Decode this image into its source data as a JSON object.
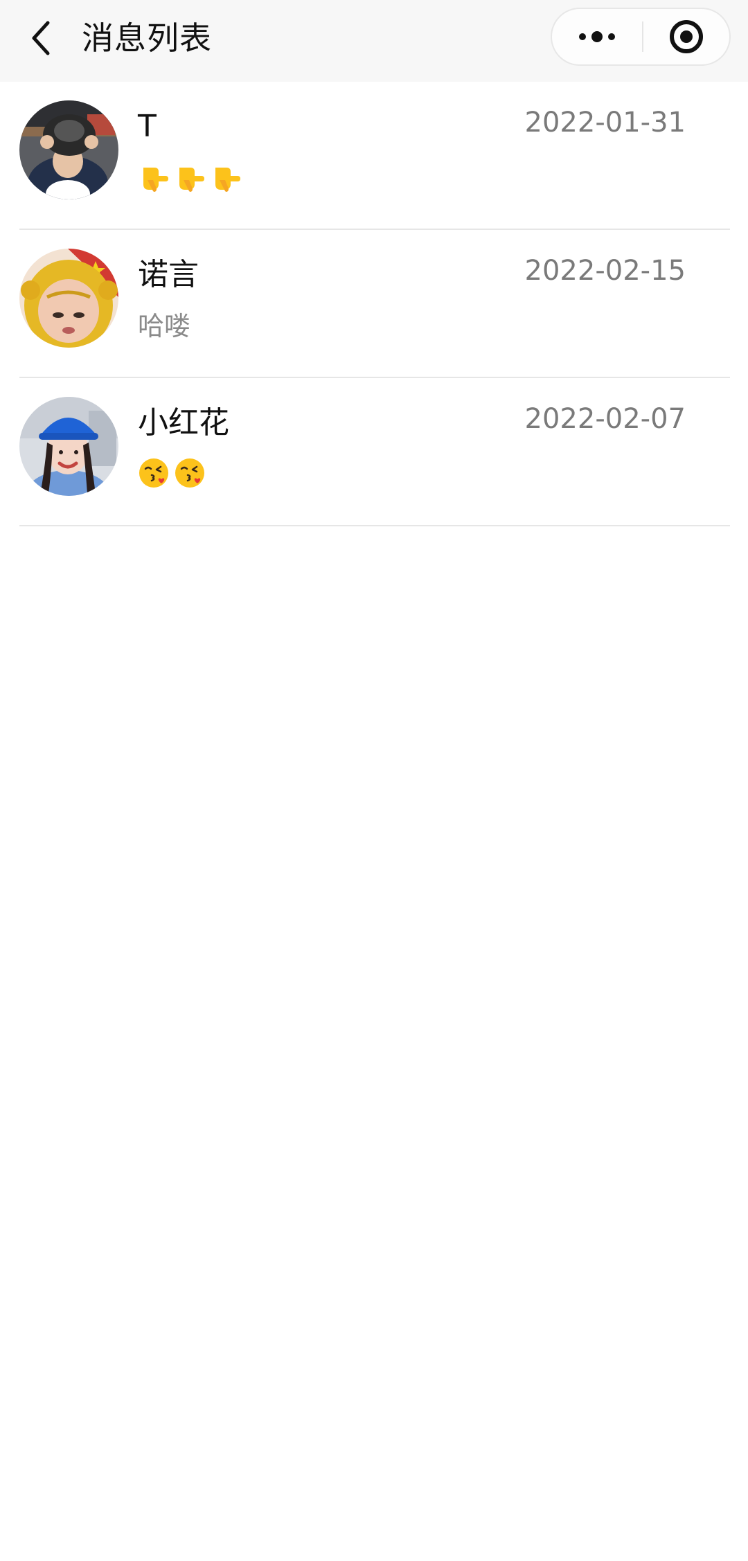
{
  "navbar": {
    "title": "消息列表"
  },
  "icons": {
    "back": "chevron-left-icon",
    "more": "more-dots-icon",
    "close": "target-close-icon"
  },
  "messages": [
    {
      "name": "T",
      "date": "2022-01-31",
      "preview_text": "",
      "preview_emojis": [
        "pointing-hand-emoji",
        "pointing-hand-emoji",
        "pointing-hand-emoji"
      ]
    },
    {
      "name": "诺言",
      "date": "2022-02-15",
      "preview_text": "哈喽",
      "preview_emojis": []
    },
    {
      "name": "小红花",
      "date": "2022-02-07",
      "preview_text": "",
      "preview_emojis": [
        "kissing-face-emoji",
        "kissing-face-emoji"
      ]
    }
  ],
  "colors": {
    "navbar_bg": "#f7f7f7",
    "text_primary": "#111111",
    "text_secondary": "#7a7a7a",
    "divider": "#e6e6e6"
  }
}
